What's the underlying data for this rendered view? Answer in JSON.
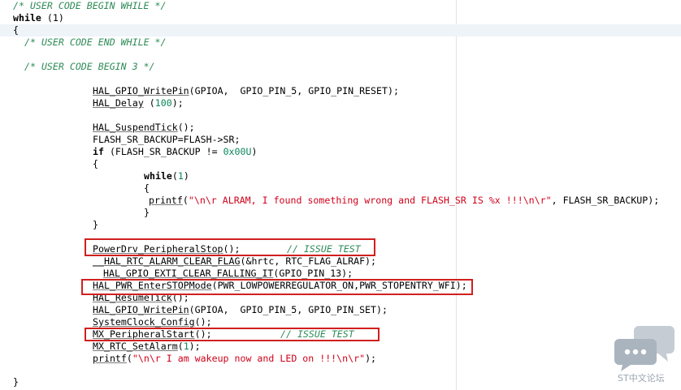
{
  "code": {
    "l1": "/* USER CODE BEGIN WHILE */",
    "l2_kw": "while",
    "l2_rest": " (1)",
    "l3": "{",
    "l4": "/* USER CODE END WHILE */",
    "l5": "/* USER CODE BEGIN 3 */",
    "l6_fn": "HAL_GPIO_WritePin",
    "l6_rest": "(GPIOA,  GPIO_PIN_5, GPIO_PIN_RESET);",
    "l7_fn": "HAL_Delay",
    "l7_a": " (",
    "l7_num": "100",
    "l7_b": ");",
    "l8_fn": "HAL_SuspendTick",
    "l8_rest": "();",
    "l9": "FLASH_SR_BACKUP=FLASH->SR;",
    "l10_kw": "if",
    "l10_a": " (FLASH_SR_BACKUP != ",
    "l10_num": "0x00U",
    "l10_b": ")",
    "l11": "{",
    "l12_kw": "while",
    "l12_a": "(",
    "l12_num": "1",
    "l12_b": ")",
    "l13": "{",
    "l14_fn": "printf",
    "l14_a": "(",
    "l14_str": "\"\\n\\r ALRAM, I found something wrong and FLASH_SR IS %x !!!\\n\\r\"",
    "l14_b": ", FLASH_SR_BACKUP);",
    "l15": "}",
    "l16": "}",
    "l17_fn": "PowerDrv_PeripheralStop",
    "l17_rest": "();",
    "l17_cm": "// ISSUE TEST",
    "l18_fn": "__HAL_RTC_ALARM_CLEAR_FLAG",
    "l18_rest": "(&hrtc, RTC_FLAG_ALRAF);",
    "l19_fn": "HAL_GPIO_EXTI_CLEAR_FALLING_IT",
    "l19_rest": "(GPIO_PIN_13);",
    "l20_fn": "HAL_PWR_EnterSTOPMode",
    "l20_rest": "(PWR_LOWPOWERREGULATOR_ON,PWR_STOPENTRY_WFI);",
    "l21_fn": "HAL_ResumeTick",
    "l21_rest": "();",
    "l22_fn": "HAL_GPIO_WritePin",
    "l22_rest": "(GPIOA,  GPIO_PIN_5, GPIO_PIN_SET);",
    "l23_fn": "SystemClock_Config",
    "l23_rest": "();",
    "l24_fn": "MX_PeripheralStart",
    "l24_rest": "();",
    "l24_cm": "// ISSUE TEST",
    "l25_fn": "MX_RTC_SetAlarm",
    "l25_a": "(",
    "l25_num": "1",
    "l25_b": ");",
    "l26_fn": "printf",
    "l26_a": "(",
    "l26_str": "\"\\n\\r I am wakeup now and LED on !!!\\n\\r\"",
    "l26_b": ");",
    "l27": "}"
  },
  "watermark": {
    "text": "ST中文论坛",
    "icon": "chat-bubbles-icon"
  },
  "colors": {
    "comment": "#2e8b57",
    "string": "#d0021b",
    "number": "#098658",
    "highlight_box": "#d0201e",
    "current_line": "#eef4f8"
  }
}
